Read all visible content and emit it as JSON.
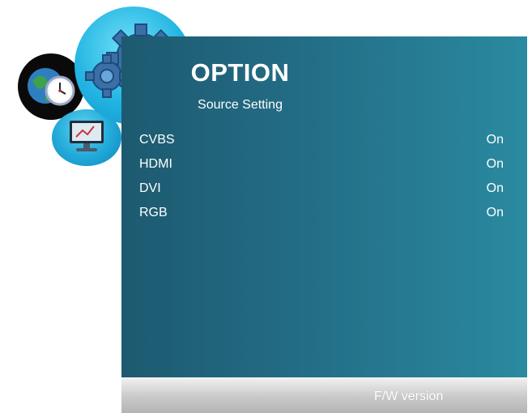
{
  "header": {
    "title": "OPTION",
    "subtitle": "Source Setting"
  },
  "sources": [
    {
      "label": "CVBS",
      "value": "On"
    },
    {
      "label": "HDMI",
      "value": "On"
    },
    {
      "label": "DVI",
      "value": "On"
    },
    {
      "label": "RGB",
      "value": "On"
    }
  ],
  "footer": {
    "label": "F/W version"
  },
  "icons": {
    "gear": "gear-icon",
    "globe_clock": "globe-clock-icon",
    "monitor": "monitor-icon"
  },
  "colors": {
    "panel_dark": "#1d5a70",
    "panel_light": "#2a8aa0",
    "accent_cyan": "#22b4e2",
    "text": "#ffffff"
  }
}
